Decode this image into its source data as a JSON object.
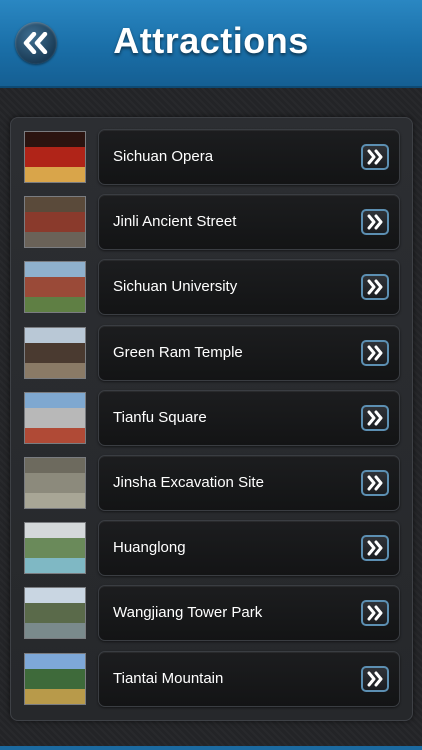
{
  "header": {
    "title": "Attractions",
    "back_icon": "double-chevron-left-icon"
  },
  "colors": {
    "header": "#1a6fa8",
    "accent_border": "#5c8fb2",
    "background": "#232427"
  },
  "attractions": [
    {
      "label": "Sichuan Opera",
      "thumb": [
        "#2b1410",
        "#b02418",
        "#d9a54a"
      ]
    },
    {
      "label": "Jinli Ancient Street",
      "thumb": [
        "#5a4a3a",
        "#8a3a2c",
        "#6a6258"
      ]
    },
    {
      "label": "Sichuan University",
      "thumb": [
        "#8fb0cc",
        "#9a4a38",
        "#5f7f44"
      ]
    },
    {
      "label": "Green Ram Temple",
      "thumb": [
        "#b9c8d6",
        "#4a3a30",
        "#8a7a66"
      ]
    },
    {
      "label": "Tianfu Square",
      "thumb": [
        "#7fa8d0",
        "#b8b8b8",
        "#b04a36"
      ]
    },
    {
      "label": "Jinsha Excavation Site",
      "thumb": [
        "#6d6a5e",
        "#8c8a7c",
        "#a8a696"
      ]
    },
    {
      "label": "Huanglong",
      "thumb": [
        "#d4d8da",
        "#6a8a5a",
        "#7fb8c4"
      ]
    },
    {
      "label": "Wangjiang Tower Park",
      "thumb": [
        "#c9d6e2",
        "#5a6a4a",
        "#7a8a8c"
      ]
    },
    {
      "label": "Tiantai Mountain",
      "thumb": [
        "#7ea8d8",
        "#3e6a3a",
        "#b89a4a"
      ]
    }
  ]
}
